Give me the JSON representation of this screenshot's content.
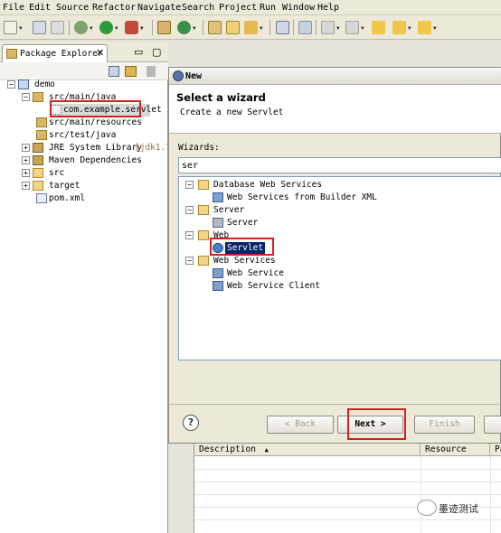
{
  "menu": [
    {
      "label": "File"
    },
    {
      "label": "Edit"
    },
    {
      "label": "Source"
    },
    {
      "label": "Refactor"
    },
    {
      "label": "Navigate"
    },
    {
      "label": "Search"
    },
    {
      "label": "Project"
    },
    {
      "label": "Run"
    },
    {
      "label": "Window"
    },
    {
      "label": "Help"
    }
  ],
  "package_explorer": {
    "tab_label": "Package Explorer",
    "tree": [
      {
        "label": "demo"
      },
      {
        "label": "src/main/java"
      },
      {
        "label": "com.example.servlet"
      },
      {
        "label": "src/main/resources"
      },
      {
        "label": "src/test/java"
      },
      {
        "label": "JRE System Library",
        "decoration": "[jdk1.7."
      },
      {
        "label": "Maven Dependencies"
      },
      {
        "label": "src"
      },
      {
        "label": "target"
      },
      {
        "label": "pom.xml"
      }
    ]
  },
  "dialog": {
    "title": "New",
    "wizard_title": "Select a wizard",
    "wizard_desc": "Create a new Servlet",
    "wizards_label": "Wizards:",
    "filter_value": "ser",
    "tree": [
      {
        "label": "Database Web Services"
      },
      {
        "label": "Web Services from Builder XML"
      },
      {
        "label": "Server"
      },
      {
        "label": "Server"
      },
      {
        "label": "Web"
      },
      {
        "label": "Servlet"
      },
      {
        "label": "Web Services"
      },
      {
        "label": "Web Service"
      },
      {
        "label": "Web Service Client"
      }
    ],
    "buttons": {
      "help": "?",
      "back": "< Back",
      "next": "Next >",
      "finish": "Finish"
    }
  },
  "problems": {
    "columns": [
      "Description",
      "Resource",
      "Pa"
    ]
  },
  "watermark": "墨迹测试",
  "colors": {
    "highlight_red": "#d22020",
    "selection": "#0a246a"
  }
}
